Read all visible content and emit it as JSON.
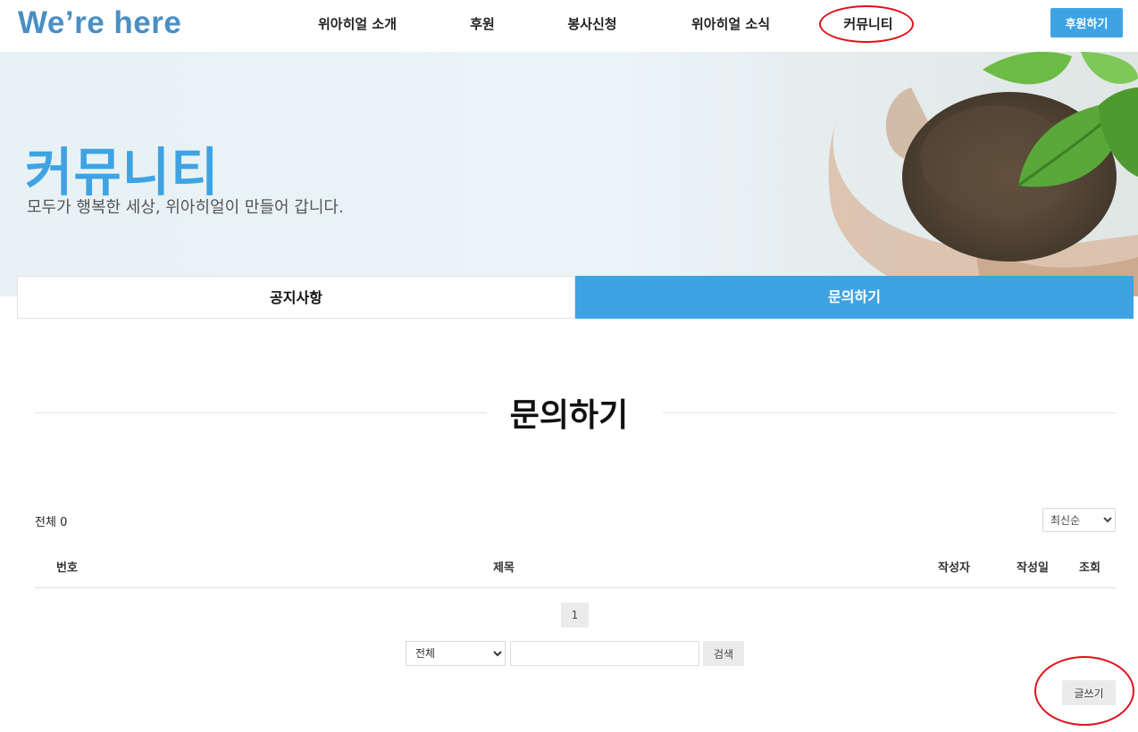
{
  "header": {
    "logo": "We’re here",
    "nav": [
      {
        "label": "위아히얼 소개"
      },
      {
        "label": "후원"
      },
      {
        "label": "봉사신청"
      },
      {
        "label": "위아히얼 소식"
      },
      {
        "label": "커뮤니티"
      }
    ],
    "donate_label": "후원하기"
  },
  "hero": {
    "title": "커뮤니티",
    "subtitle": "모두가 행복한 세상, 위아히얼이 만들어 갑니다."
  },
  "tabs": [
    {
      "label": "공지사항",
      "active": false
    },
    {
      "label": "문의하기",
      "active": true
    }
  ],
  "section": {
    "title": "문의하기"
  },
  "board": {
    "total_label": "전체",
    "total_count": "0",
    "sort": {
      "selected": "최신순"
    },
    "columns": [
      "번호",
      "제목",
      "작성자",
      "작성일",
      "조회"
    ],
    "page": "1",
    "search": {
      "field_selected": "전체",
      "value": "",
      "button_label": "검색"
    },
    "write_label": "글쓰기"
  },
  "colors": {
    "accent": "#3ea3e3",
    "logo": "#4a8fc4",
    "annotation": "#e0111a"
  },
  "annotations": [
    "nav-community-highlight",
    "write-button-highlight"
  ]
}
